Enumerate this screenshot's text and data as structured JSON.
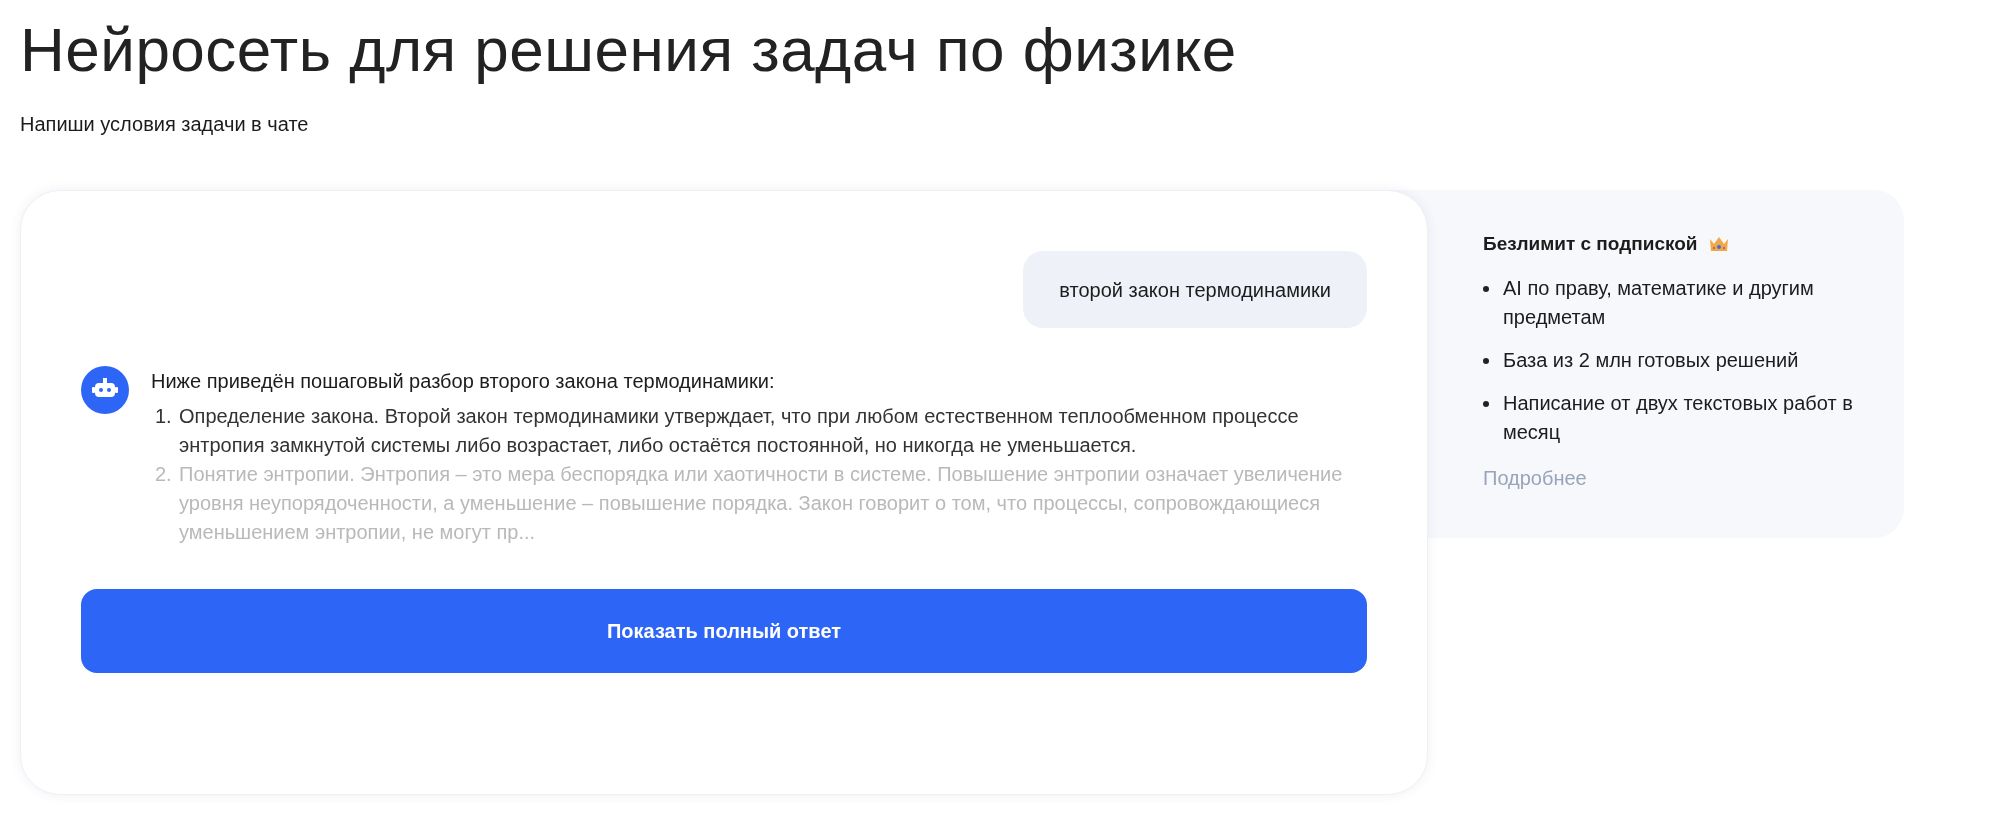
{
  "heading": "Нейросеть для решения задач по физике",
  "subheading": "Напиши условия задачи в чате",
  "chat": {
    "user_message": "второй закон термодинамики",
    "bot_intro": "Ниже приведён пошаговый разбор второго закона термодинамики:",
    "steps": [
      {
        "number": "1.",
        "text": "Определение закона. Второй закон термодинамики утверждает, что при любом естественном теплообменном процессе энтропия замкнутой системы либо возрастает, либо остаётся постоянной, но никогда не уменьшается.",
        "faded": false
      },
      {
        "number": "2.",
        "text": "Понятие энтропии. Энтропия – это мера беспорядка или хаотичности в системе. Повышение энтропии означает увеличение уровня неупорядоченности, а уменьшение – повышение порядка. Закон говорит о том, что процессы, сопровождающиеся уменьшением энтропии, не могут пр...",
        "faded": true
      }
    ],
    "button": "Показать полный ответ"
  },
  "promo": {
    "title": "Безлимит с подпиской",
    "features": [
      "AI по праву, математике и другим предметам",
      "База из 2 млн готовых решений",
      "Написание от двух текстовых работ в месяц"
    ],
    "link": "Подробнее"
  }
}
